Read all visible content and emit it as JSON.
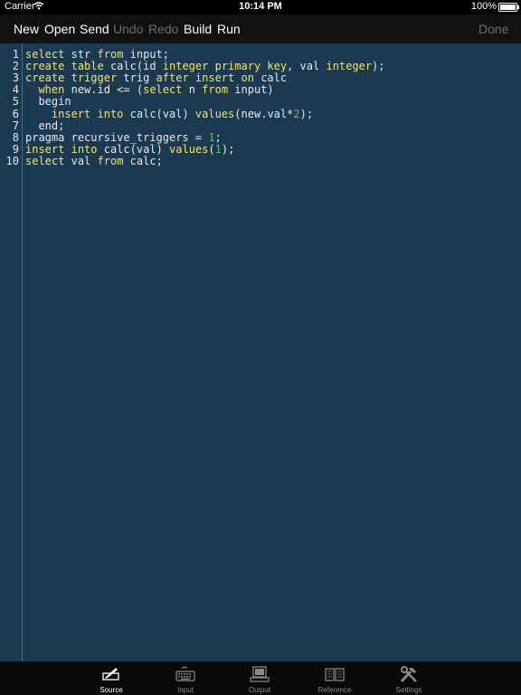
{
  "status_bar": {
    "carrier": "Carrier",
    "time": "10:14 PM",
    "battery": "100%"
  },
  "toolbar": {
    "new_label": "New",
    "open_label": "Open",
    "send_label": "Send",
    "undo_label": "Undo",
    "redo_label": "Redo",
    "build_label": "Build",
    "run_label": "Run",
    "done_label": "Done"
  },
  "editor": {
    "line_numbers": [
      "1",
      "2",
      "3",
      "4",
      "5",
      "6",
      "7",
      "8",
      "9",
      "10"
    ],
    "lines": [
      "select str from input;",
      "create table calc(id integer primary key, val integer);",
      "create trigger trig after insert on calc",
      "  when new.id <= (select n from input)",
      "  begin",
      "    insert into calc(val) values(new.val*2);",
      "  end;",
      "pragma recursive_triggers = 1;",
      "insert into calc(val) values(1);",
      "select val from calc;"
    ]
  },
  "tabbar": {
    "tabs": [
      {
        "label": "Source",
        "icon": "source-icon"
      },
      {
        "label": "Input",
        "icon": "keyboard-icon"
      },
      {
        "label": "Output",
        "icon": "computer-icon"
      },
      {
        "label": "Reference",
        "icon": "book-icon"
      },
      {
        "label": "Settings",
        "icon": "tools-icon"
      }
    ],
    "active": "Source"
  },
  "colors": {
    "editor_background": "#1b3a52",
    "keyword": "#f4e36c",
    "number": "#52cc52",
    "text": "#e8e8e8"
  }
}
